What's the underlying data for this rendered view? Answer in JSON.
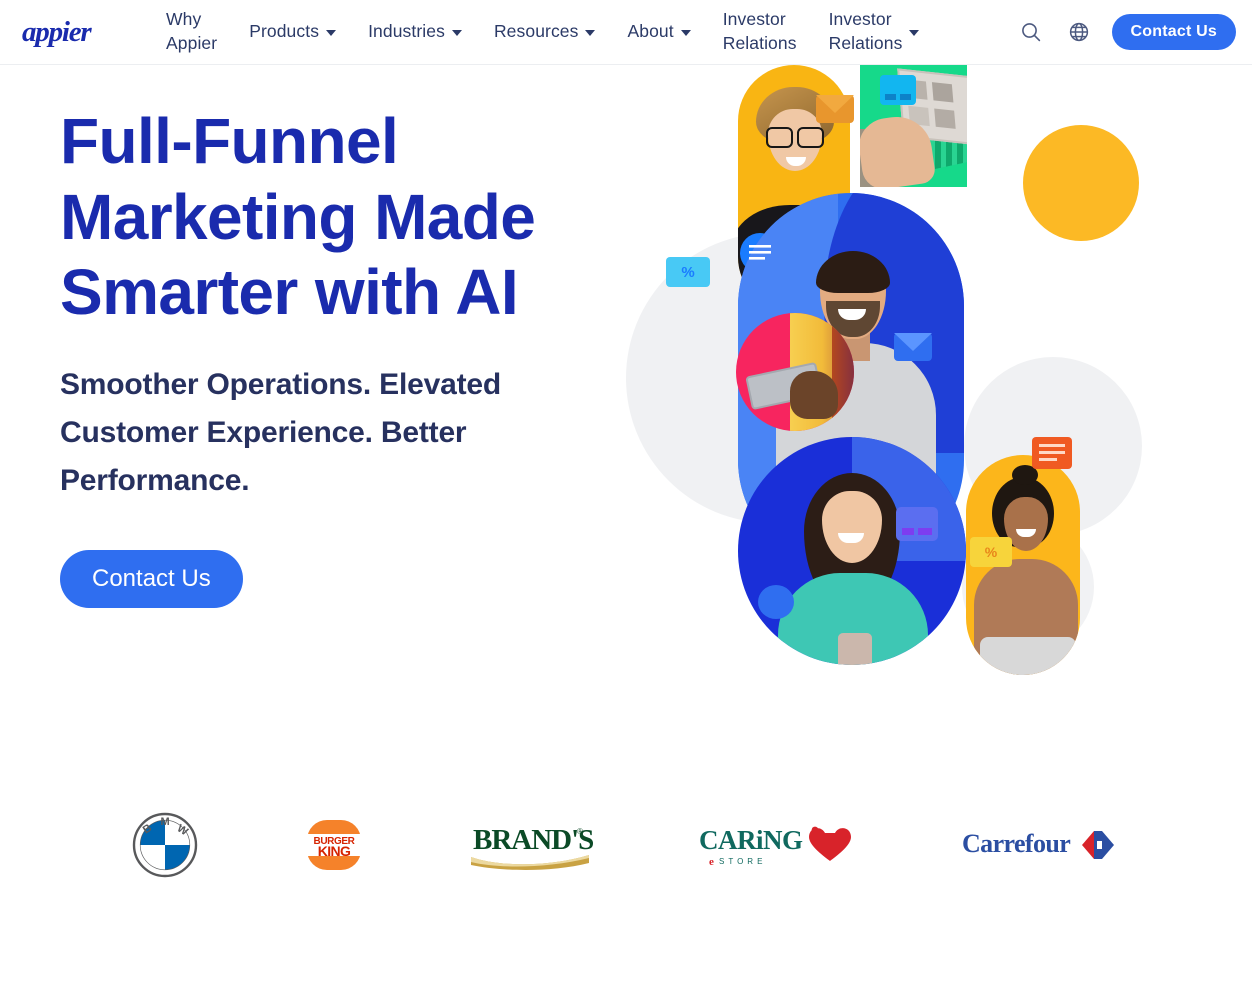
{
  "header": {
    "brand": {
      "name": "Appier",
      "logo_icon": "appier-wordmark",
      "color": "#1a2bad"
    },
    "nav": [
      {
        "label": "Why\nAppier",
        "has_dropdown": false,
        "wrap": true
      },
      {
        "label": "Products",
        "has_dropdown": true,
        "wrap": false
      },
      {
        "label": "Industries",
        "has_dropdown": true,
        "wrap": false
      },
      {
        "label": "Resources",
        "has_dropdown": true,
        "wrap": false
      },
      {
        "label": "About",
        "has_dropdown": true,
        "wrap": false
      },
      {
        "label": "Investor\nRelations",
        "has_dropdown": false,
        "wrap": true
      },
      {
        "label": "Investor\nRelations",
        "has_dropdown": true,
        "wrap": true
      }
    ],
    "tools": {
      "search_icon": "search-icon",
      "language_icon": "globe-icon",
      "contact_label": "Contact Us"
    }
  },
  "hero": {
    "title": "Full-Funnel Marketing Made Smarter with AI",
    "subtitle": "Smoother Operations. Elevated Customer Experience. Better Performance.",
    "cta_label": "Contact Us",
    "title_color": "#1a2bad",
    "subtitle_color": "#27315f",
    "accent_color": "#2f6ef0",
    "collage": {
      "badges": [
        "envelope-orange-icon",
        "chat-bubble-blue-icon",
        "credit-card-cyan-icon",
        "coupon-percent-cyan-icon",
        "envelope-blue-icon",
        "chat-bubble-navy-icon",
        "card-purple-icon",
        "chat-bubble-orange-icon",
        "coupon-percent-yellow-icon"
      ],
      "shape_colors": {
        "yellow": "#f9b513",
        "green": "#16d98a",
        "blue": "#2f6ef0",
        "navy": "#1a2fd8",
        "pink": "#f7255f",
        "grey": "#f0f1f3",
        "amber_circle": "#fcb925"
      }
    }
  },
  "logos": [
    {
      "name": "BMW",
      "icon": "bmw-logo"
    },
    {
      "name": "BURGER KING",
      "icon": "burger-king-logo"
    },
    {
      "name": "BRAND'S",
      "icon": "brands-logo"
    },
    {
      "name": "CARING eSTORE",
      "icon": "caring-estore-logo"
    },
    {
      "name": "Carrefour",
      "icon": "carrefour-logo"
    }
  ]
}
